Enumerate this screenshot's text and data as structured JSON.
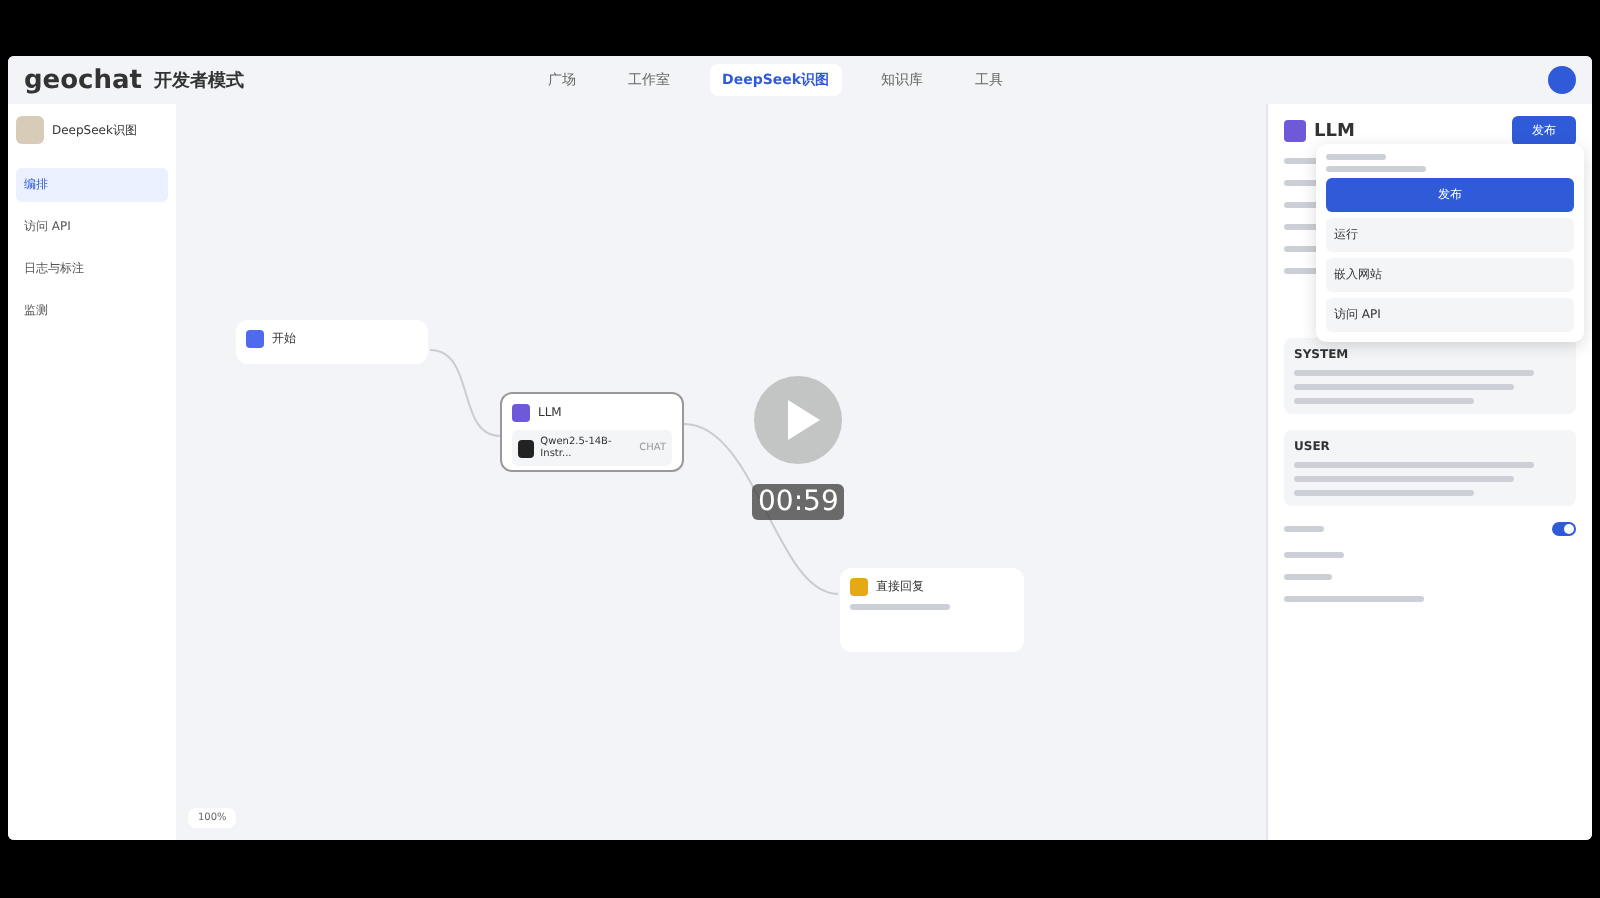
{
  "video": {
    "timestamp": "00:59"
  },
  "header": {
    "logo": "geochat",
    "mode": "开发者模式",
    "nav": [
      {
        "label": "广场",
        "selected": false
      },
      {
        "label": "工作室",
        "selected": false
      },
      {
        "label": "DeepSeek识图",
        "selected": true
      },
      {
        "label": "知识库",
        "selected": false
      },
      {
        "label": "工具",
        "selected": false
      }
    ]
  },
  "sidebar": {
    "app_name": "DeepSeek识图",
    "items": [
      {
        "label": "编排",
        "selected": true
      },
      {
        "label": "访问 API",
        "selected": false
      },
      {
        "label": "日志与标注",
        "selected": false
      },
      {
        "label": "监测",
        "selected": false
      }
    ]
  },
  "toolbar": {
    "publish": "发布"
  },
  "canvas": {
    "nodes": [
      {
        "kind": "start",
        "title": "开始",
        "color": "#4f6bed"
      },
      {
        "kind": "llm",
        "title": "LLM",
        "model": "Qwen2.5-14B-Instr...",
        "badge": "CHAT",
        "color": "#6e59d9"
      },
      {
        "kind": "answer",
        "title": "直接回复",
        "color": "#e6a817"
      }
    ],
    "zoom": "100%"
  },
  "panel": {
    "title": "LLM",
    "sections": [
      "SYSTEM",
      "USER"
    ],
    "memory_on": true
  },
  "publish_menu": {
    "button": "发布",
    "items": [
      "运行",
      "嵌入网站",
      "访问 API"
    ]
  }
}
